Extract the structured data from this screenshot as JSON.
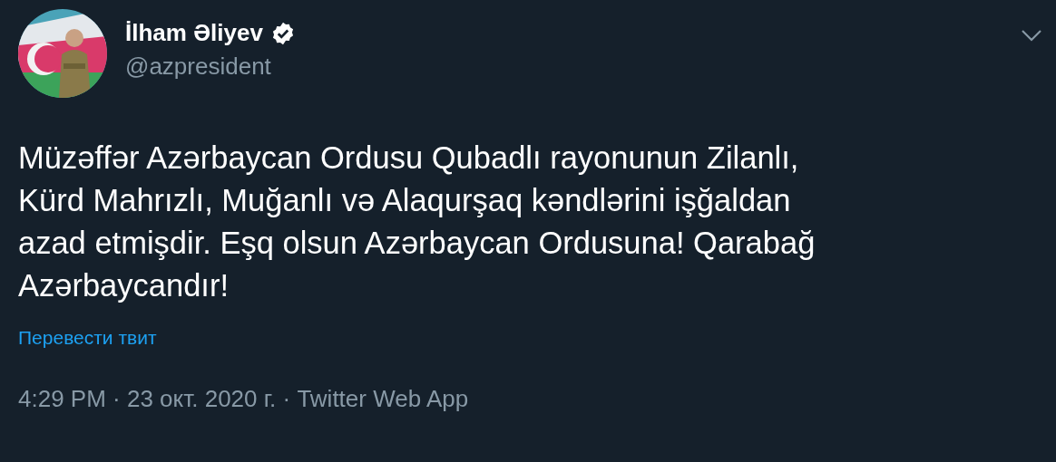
{
  "author": {
    "name": "İlham Əliyev",
    "verified": true,
    "handle": "@azpresident"
  },
  "tweet": {
    "text_lines": [
      "Müzəffər Azərbaycan Ordusu Qubadlı rayonunun Zilanlı,",
      "Kürd Mahrızlı, Muğanlı və Alaqurşaq kəndlərini işğaldan",
      "azad etmişdir. Eşq olsun Azərbaycan Ordusuna! Qarabağ",
      "Azərbaycandır!"
    ],
    "translate_link": "Перевести твит",
    "meta": "4:29 PM · 23 окт. 2020 г. · Twitter Web App"
  }
}
